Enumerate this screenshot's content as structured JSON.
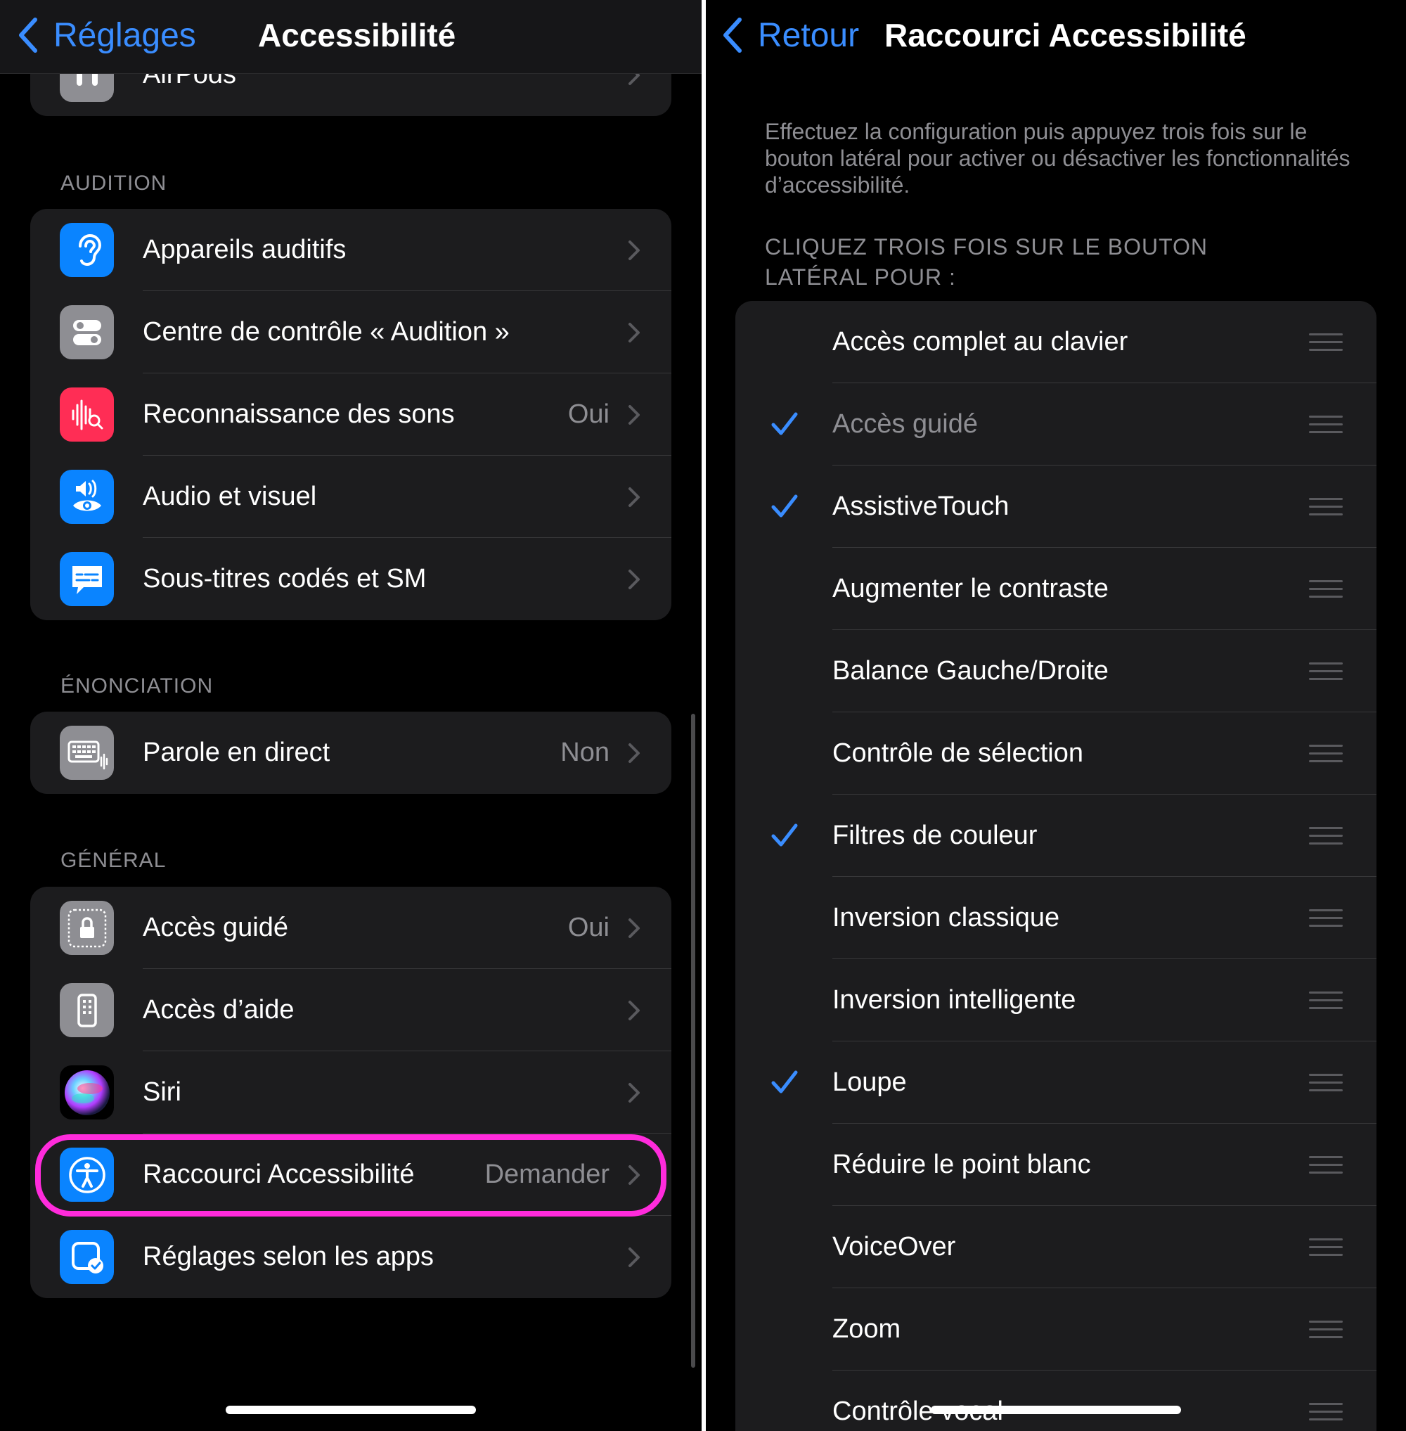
{
  "colors": {
    "accent": "#3a8dff",
    "highlight": "#ff2bdc",
    "background": "#000000",
    "cell": "#1c1c1e"
  },
  "left": {
    "back_label": "Réglages",
    "title": "Accessibilité",
    "partial_row": {
      "label": "AirPods",
      "icon": "airpods-icon"
    },
    "sections": [
      {
        "header": "AUDITION",
        "rows": [
          {
            "label": "Appareils auditifs",
            "value": "",
            "icon": "ear-icon",
            "color": "#0a84ff"
          },
          {
            "label": "Centre de contrôle « Audition »",
            "value": "",
            "icon": "toggles-icon",
            "color": "#8e8e93"
          },
          {
            "label": "Reconnaissance des sons",
            "value": "Oui",
            "icon": "sound-wave-search-icon",
            "color": "#ff2d55"
          },
          {
            "label": "Audio et visuel",
            "value": "",
            "icon": "speaker-eye-icon",
            "color": "#0a84ff"
          },
          {
            "label": "Sous-titres codés et SM",
            "value": "",
            "icon": "captions-icon",
            "color": "#0a84ff"
          }
        ]
      },
      {
        "header": "ÉNONCIATION",
        "rows": [
          {
            "label": "Parole en direct",
            "value": "Non",
            "icon": "keyboard-icon",
            "color": "#8e8e93"
          }
        ]
      },
      {
        "header": "GÉNÉRAL",
        "rows": [
          {
            "label": "Accès guidé",
            "value": "Oui",
            "icon": "lock-icon",
            "color": "#8e8e93"
          },
          {
            "label": "Accès d’aide",
            "value": "",
            "icon": "remote-icon",
            "color": "#8e8e93"
          },
          {
            "label": "Siri",
            "value": "",
            "icon": "siri-icon",
            "color": "#000000"
          },
          {
            "label": "Raccourci Accessibilité",
            "value": "Demander",
            "icon": "accessibility-icon",
            "color": "#0a84ff"
          },
          {
            "label": "Réglages selon les apps",
            "value": "",
            "icon": "app-settings-icon",
            "color": "#0a84ff"
          }
        ]
      }
    ]
  },
  "right": {
    "back_label": "Retour",
    "title": "Raccourci Accessibilité",
    "description": "Effectuez la configuration puis appuyez trois fois sur le bouton latéral pour activer ou désactiver les fonctionnalités d’accessibilité.",
    "section_header": "CLIQUEZ TROIS FOIS SUR LE BOUTON LATÉRAL POUR :",
    "items": [
      {
        "label": "Accès complet au clavier",
        "checked": false,
        "dimmed": false
      },
      {
        "label": "Accès guidé",
        "checked": true,
        "dimmed": true
      },
      {
        "label": "AssistiveTouch",
        "checked": true,
        "dimmed": false
      },
      {
        "label": "Augmenter le contraste",
        "checked": false,
        "dimmed": false
      },
      {
        "label": "Balance Gauche/Droite",
        "checked": false,
        "dimmed": false
      },
      {
        "label": "Contrôle de sélection",
        "checked": false,
        "dimmed": false
      },
      {
        "label": "Filtres de couleur",
        "checked": true,
        "dimmed": false
      },
      {
        "label": "Inversion classique",
        "checked": false,
        "dimmed": false
      },
      {
        "label": "Inversion intelligente",
        "checked": false,
        "dimmed": false
      },
      {
        "label": "Loupe",
        "checked": true,
        "dimmed": false
      },
      {
        "label": "Réduire le point blanc",
        "checked": false,
        "dimmed": false
      },
      {
        "label": "VoiceOver",
        "checked": false,
        "dimmed": false
      },
      {
        "label": "Zoom",
        "checked": false,
        "dimmed": false
      },
      {
        "label": "Contrôle vocal",
        "checked": false,
        "dimmed": false
      }
    ]
  }
}
